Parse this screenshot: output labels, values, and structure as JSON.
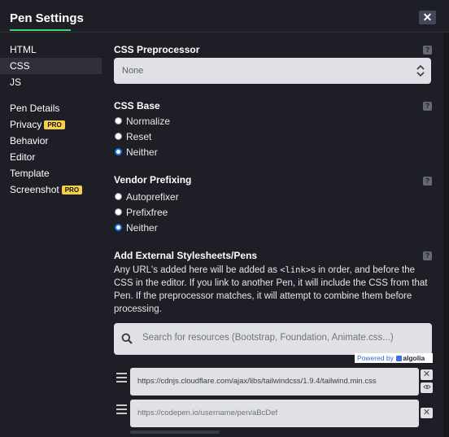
{
  "window": {
    "title": "Pen Settings",
    "close_label": "✕"
  },
  "sidebar": {
    "items": [
      {
        "label": "HTML",
        "pro": ""
      },
      {
        "label": "CSS",
        "pro": ""
      },
      {
        "label": "JS",
        "pro": ""
      },
      {
        "label": "Pen Details",
        "pro": ""
      },
      {
        "label": "Privacy",
        "pro": "PRO"
      },
      {
        "label": "Behavior",
        "pro": ""
      },
      {
        "label": "Editor",
        "pro": ""
      },
      {
        "label": "Template",
        "pro": ""
      },
      {
        "label": "Screenshot",
        "pro": "PRO"
      }
    ],
    "active": "CSS"
  },
  "preprocessor": {
    "title": "CSS Preprocessor",
    "help": "?",
    "selected": "None"
  },
  "css_base": {
    "title": "CSS Base",
    "help": "?",
    "options": [
      "Normalize",
      "Reset",
      "Neither"
    ],
    "selected": "Neither"
  },
  "vendor_prefixing": {
    "title": "Vendor Prefixing",
    "help": "?",
    "options": [
      "Autoprefixer",
      "Prefixfree",
      "Neither"
    ],
    "selected": "Neither"
  },
  "external": {
    "title": "Add External Stylesheets/Pens",
    "help": "?",
    "desc_before": "Any URL's added here will be added as ",
    "desc_code": "<link>",
    "desc_after": "s in order, and before the CSS in the editor. If you link to another Pen, it will include the CSS from that Pen. If the preprocessor matches, it will attempt to combine them before processing.",
    "search_placeholder": "Search for resources (Bootstrap, Foundation, Animate.css...)",
    "powered_by": "Powered by",
    "algolia": "algolia",
    "resources": [
      {
        "value": "https://cdnjs.cloudflare.com/ajax/libs/tailwindcss/1.9.4/tailwind.min.css",
        "placeholder": ""
      },
      {
        "value": "",
        "placeholder": "https://codepen.io/username/pen/aBcDef"
      }
    ]
  },
  "colors": {
    "accent": "#47cf73",
    "pro_badge": "#f5d04a",
    "radio_checked": "#1a73e8",
    "background": "#1e1f26"
  }
}
